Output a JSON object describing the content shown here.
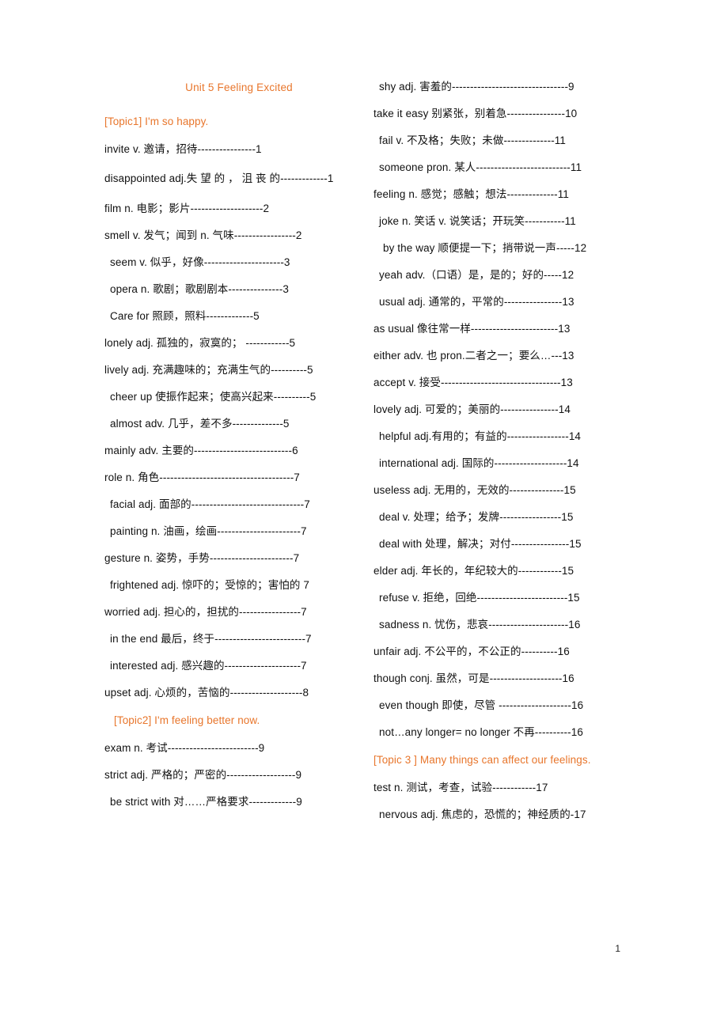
{
  "document": {
    "unit_title": "Unit 5  Feeling Excited",
    "page_number": "1",
    "accent_color": "#E8762C",
    "text_color": "#111111"
  },
  "left_column": {
    "topic1_heading": "[Topic1] I'm so happy.",
    "topic2_heading": "[Topic2] I'm feeling better now.",
    "entries_topic1": [
      {
        "text": "invite  v. 邀请，招待----------------1",
        "indent": 0,
        "wrap": false
      },
      {
        "text": "disappointed  adj.失 望 的 ， 沮 丧 的-------------1",
        "indent": 0,
        "wrap": true
      },
      {
        "text": "film  n. 电影；影片--------------------2",
        "indent": 0,
        "wrap": false
      },
      {
        "text": "smell  v. 发气；闻到 n. 气味-----------------2",
        "indent": 0,
        "wrap": false
      },
      {
        "text": "seem  v.  似乎，好像----------------------3",
        "indent": 1,
        "wrap": false
      },
      {
        "text": "opera  n. 歌剧；歌剧剧本---------------3",
        "indent": 1,
        "wrap": false
      },
      {
        "text": "Care  for  照顾，照料-------------5",
        "indent": 1,
        "wrap": false
      },
      {
        "text": "lonely  adj. 孤独的，寂寞的； ------------5",
        "indent": 0,
        "wrap": false
      },
      {
        "text": "lively adj. 充满趣味的；充满生气的----------5",
        "indent": 0,
        "wrap": false
      },
      {
        "text": "cheer up  使振作起来；使高兴起来----------5",
        "indent": 1,
        "wrap": false
      },
      {
        "text": "almost  adv. 几乎，差不多--------------5",
        "indent": 1,
        "wrap": false
      },
      {
        "text": "mainly  adv. 主要的---------------------------6",
        "indent": 0,
        "wrap": false
      },
      {
        "text": "role  n. 角色-------------------------------------7",
        "indent": 0,
        "wrap": false
      },
      {
        "text": "facial  adj. 面部的-------------------------------7",
        "indent": 1,
        "wrap": false
      },
      {
        "text": "painting  n. 油画，绘画-----------------------7",
        "indent": 1,
        "wrap": false
      },
      {
        "text": "gesture  n. 姿势，手势-----------------------7",
        "indent": 0,
        "wrap": false
      },
      {
        "text": "frightened  adj. 惊吓的；受惊的；害怕的 7",
        "indent": 1,
        "wrap": false
      },
      {
        "text": "worried  adj. 担心的，担扰的-----------------7",
        "indent": 0,
        "wrap": false
      },
      {
        "text": "in the end  最后，终于-------------------------7",
        "indent": 1,
        "wrap": false
      },
      {
        "text": "interested  adj. 感兴趣的---------------------7",
        "indent": 1,
        "wrap": false
      },
      {
        "text": "upset  adj. 心烦的，苦恼的--------------------8",
        "indent": 0,
        "wrap": false
      }
    ],
    "entries_topic2": [
      {
        "text": "exam  n. 考试-------------------------9",
        "indent": 0,
        "wrap": false
      },
      {
        "text": "strict  adj. 严格的；严密的-------------------9",
        "indent": 0,
        "wrap": false
      },
      {
        "text": "be strict with  对……严格要求-------------9",
        "indent": 1,
        "wrap": false
      }
    ]
  },
  "right_column": {
    "topic3_heading": "[Topic 3 ] Many things can affect our feelings.",
    "entries_topic2_cont": [
      {
        "text": "shy  adj. 害羞的--------------------------------9",
        "indent": 1,
        "wrap": false
      },
      {
        "text": "take it easy  别紧张，别着急----------------10",
        "indent": 0,
        "wrap": false
      },
      {
        "text": "fail  v. 不及格；失败；未做--------------11",
        "indent": 1,
        "wrap": false
      },
      {
        "text": "someone  pron. 某人--------------------------11",
        "indent": 1,
        "wrap": false
      },
      {
        "text": "feeling  n. 感觉；感触；想法--------------11",
        "indent": 0,
        "wrap": false
      },
      {
        "text": "joke  n. 笑话 v. 说笑话；开玩笑-----------11",
        "indent": 1,
        "wrap": false
      },
      {
        "text": "by the way 顺便提一下；捎带说一声-----12",
        "indent": 2,
        "wrap": false
      },
      {
        "text": "yeah  adv.（口语）是，是的；好的-----12",
        "indent": 1,
        "wrap": false
      },
      {
        "text": "usual  adj. 通常的，平常的----------------13",
        "indent": 1,
        "wrap": false
      },
      {
        "text": "as usual  像往常一样------------------------13",
        "indent": 0,
        "wrap": false
      },
      {
        "text": "either  adv. 也 pron.二者之一；要么…---13",
        "indent": 0,
        "wrap": false
      },
      {
        "text": "accept v. 接受---------------------------------13",
        "indent": 0,
        "wrap": false
      },
      {
        "text": "lovely  adj. 可爱的；美丽的----------------14",
        "indent": 0,
        "wrap": false
      },
      {
        "text": "helpful  adj.有用的；有益的-----------------14",
        "indent": 1,
        "wrap": false
      },
      {
        "text": "international  adj. 国际的--------------------14",
        "indent": 1,
        "wrap": false
      },
      {
        "text": "useless  adj. 无用的，无效的---------------15",
        "indent": 0,
        "wrap": false
      },
      {
        "text": "deal  v. 处理；给予；发牌-----------------15",
        "indent": 1,
        "wrap": false
      },
      {
        "text": "deal with  处理，解决；对付----------------15",
        "indent": 1,
        "wrap": false
      },
      {
        "text": "elder  adj. 年长的，年纪较大的------------15",
        "indent": 0,
        "wrap": false
      },
      {
        "text": "refuse v. 拒绝，回绝-------------------------15",
        "indent": 1,
        "wrap": false
      },
      {
        "text": "sadness  n. 忧伤，悲哀----------------------16",
        "indent": 1,
        "wrap": false
      },
      {
        "text": "unfair  adj. 不公平的，不公正的----------16",
        "indent": 0,
        "wrap": false
      },
      {
        "text": "though  conj. 虽然，可是--------------------16",
        "indent": 0,
        "wrap": false
      },
      {
        "text": "even though  即使，尽管 --------------------16",
        "indent": 1,
        "wrap": false
      },
      {
        "text": "not…any longer= no longer  不再----------16",
        "indent": 1,
        "wrap": false
      }
    ],
    "entries_topic3": [
      {
        "text": "test  n. 测试，考查，试验------------17",
        "indent": 0,
        "wrap": false
      },
      {
        "text": "nervous adj. 焦虑的，恐慌的；神经质的-17",
        "indent": 1,
        "wrap": false
      }
    ]
  }
}
